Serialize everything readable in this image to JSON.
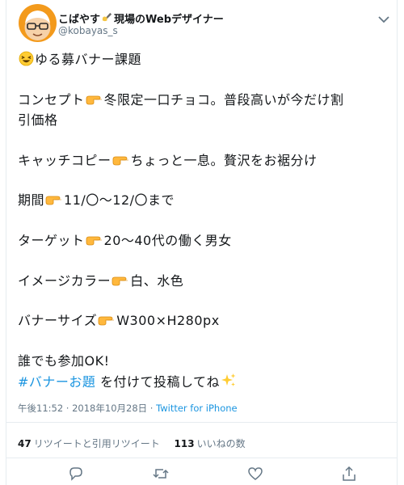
{
  "author": {
    "display_name": "こばやす",
    "display_name_suffix": "現場のWebデザイナー",
    "handle": "@kobayas_s"
  },
  "tweet": {
    "lines": [
      "ゆる募バナー課題",
      "コンセプト",
      "冬限定一口チョコ。普段高いが今だけ割",
      "引価格",
      "キャッチコピー",
      "ちょっと一息。贅沢をお裾分け",
      "期間",
      "11/〇～12/〇まで",
      "ターゲット",
      "20～40代の働く男女",
      "イメージカラー",
      "白、水色",
      "バナーサイズ",
      "W300×H280px",
      "誰でも参加OK!",
      "#バナーお題",
      " を付けて投稿してね"
    ]
  },
  "meta": {
    "time": "午後11:52 · 2018年10月28日 · ",
    "source": "Twitter for iPhone"
  },
  "stats": {
    "retweets_count": "47",
    "retweets_label": "リツイートと引用リツイート",
    "likes_count": "113",
    "likes_label": "いいねの数"
  },
  "icons": {
    "avatar": "avatar-illustration",
    "writing_hand": "writing-hand-emoji",
    "more": "chevron-down-icon",
    "laughing": "laughing-face-emoji",
    "pointing": "pointing-right-emoji",
    "sparkles": "sparkles-emoji",
    "reply": "reply-icon",
    "retweet": "retweet-icon",
    "like": "heart-icon",
    "share": "share-icon"
  },
  "colors": {
    "text": "#14171a",
    "secondary": "#657786",
    "link": "#1b95e0",
    "divider": "#e6ecf0",
    "avatar_bg": "#f39a1c"
  }
}
